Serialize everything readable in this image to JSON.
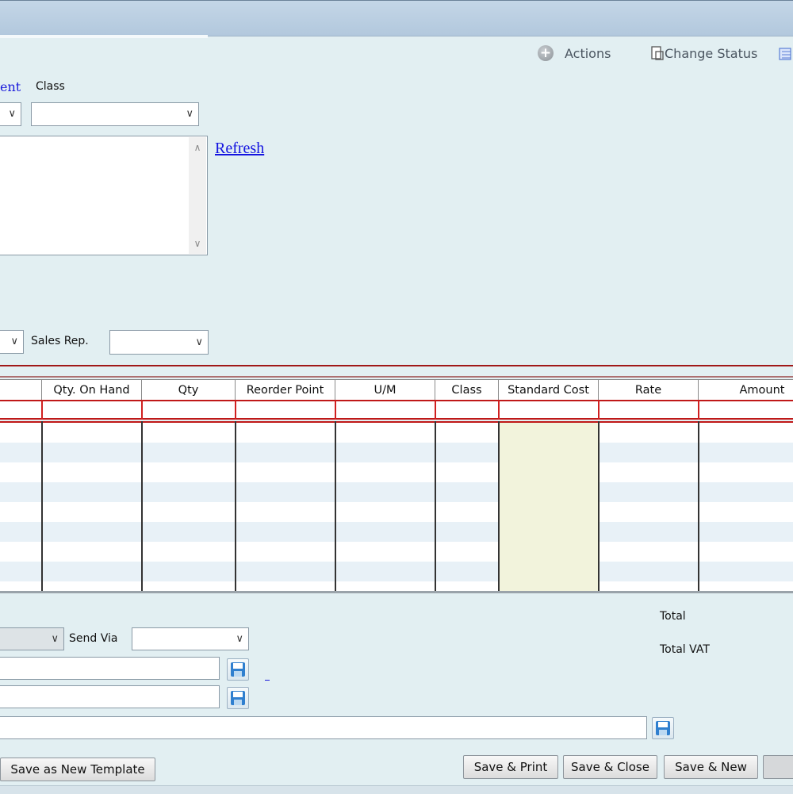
{
  "toolbar": {
    "actions_label": "Actions",
    "change_status_label": "Change Status"
  },
  "header": {
    "department_link": "ent",
    "class_label": "Class",
    "refresh_link": "Refresh",
    "sales_rep_label": "Sales Rep."
  },
  "grid": {
    "columns": [
      "Qty. On Hand",
      "Qty",
      "Reorder Point",
      "U/M",
      "Class",
      "Standard Cost",
      "Rate",
      "Amount"
    ]
  },
  "footer": {
    "send_via_label": "Send Via",
    "total_label": "Total",
    "total_vat_label": "Total VAT"
  },
  "buttons": {
    "save_template": "Save as New Template",
    "save_print": "Save & Print",
    "save_close": "Save & Close",
    "save_new": "Save & New"
  }
}
